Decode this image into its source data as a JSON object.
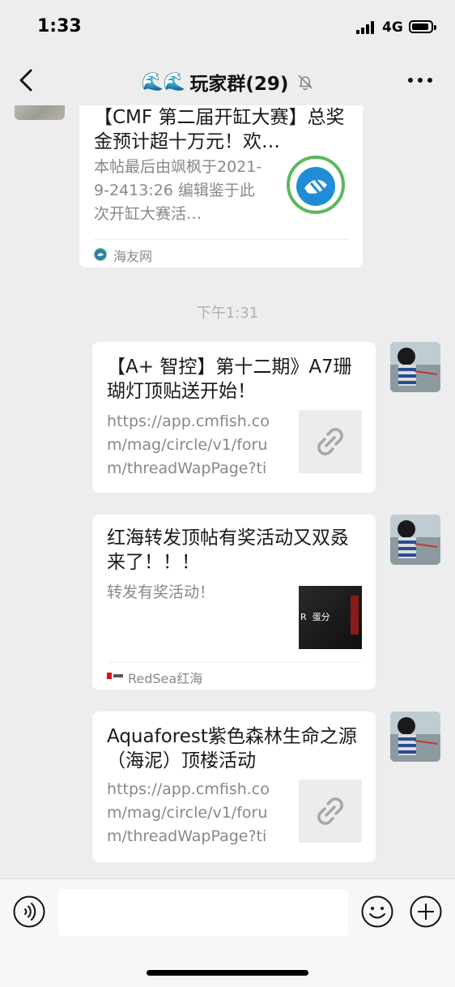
{
  "status": {
    "time": "1:33",
    "network": "4G"
  },
  "nav": {
    "title": "玩家群(29)",
    "emoji": "🌊🌊"
  },
  "messages": [
    {
      "title": "【CMF 第二届开缸大赛】总奖金预计超十万元！欢…",
      "desc": "本帖最后由飒枫于2021-9-2413:26 编辑鉴于此次开缸大赛活…",
      "source": "海友网"
    },
    {
      "title": "【A+ 智控】第十二期》A7珊 瑚灯顶贴送开始！",
      "desc": "https://app.cmfish.com/mag/circle/v1/forum/threadWapPage?tid…",
      "thumb_icon": "link-icon"
    },
    {
      "title": "红海转发顶帖有奖活动又双叒来了！！！",
      "desc": "转发有奖活动！",
      "source": "RedSea红海",
      "thumb_text": "R  蛋分"
    },
    {
      "title": "Aquaforest紫色森林生命之源（海泥）顶楼活动",
      "desc": "https://app.cmfish.com/mag/circle/v1/forum/threadWapPage?tid…",
      "thumb_icon": "link-icon"
    }
  ],
  "time_divider": "下午1:31",
  "colors": {
    "background": "#ededed",
    "card": "#ffffff",
    "muted_text": "#888888",
    "source_green": "#3aa757"
  }
}
